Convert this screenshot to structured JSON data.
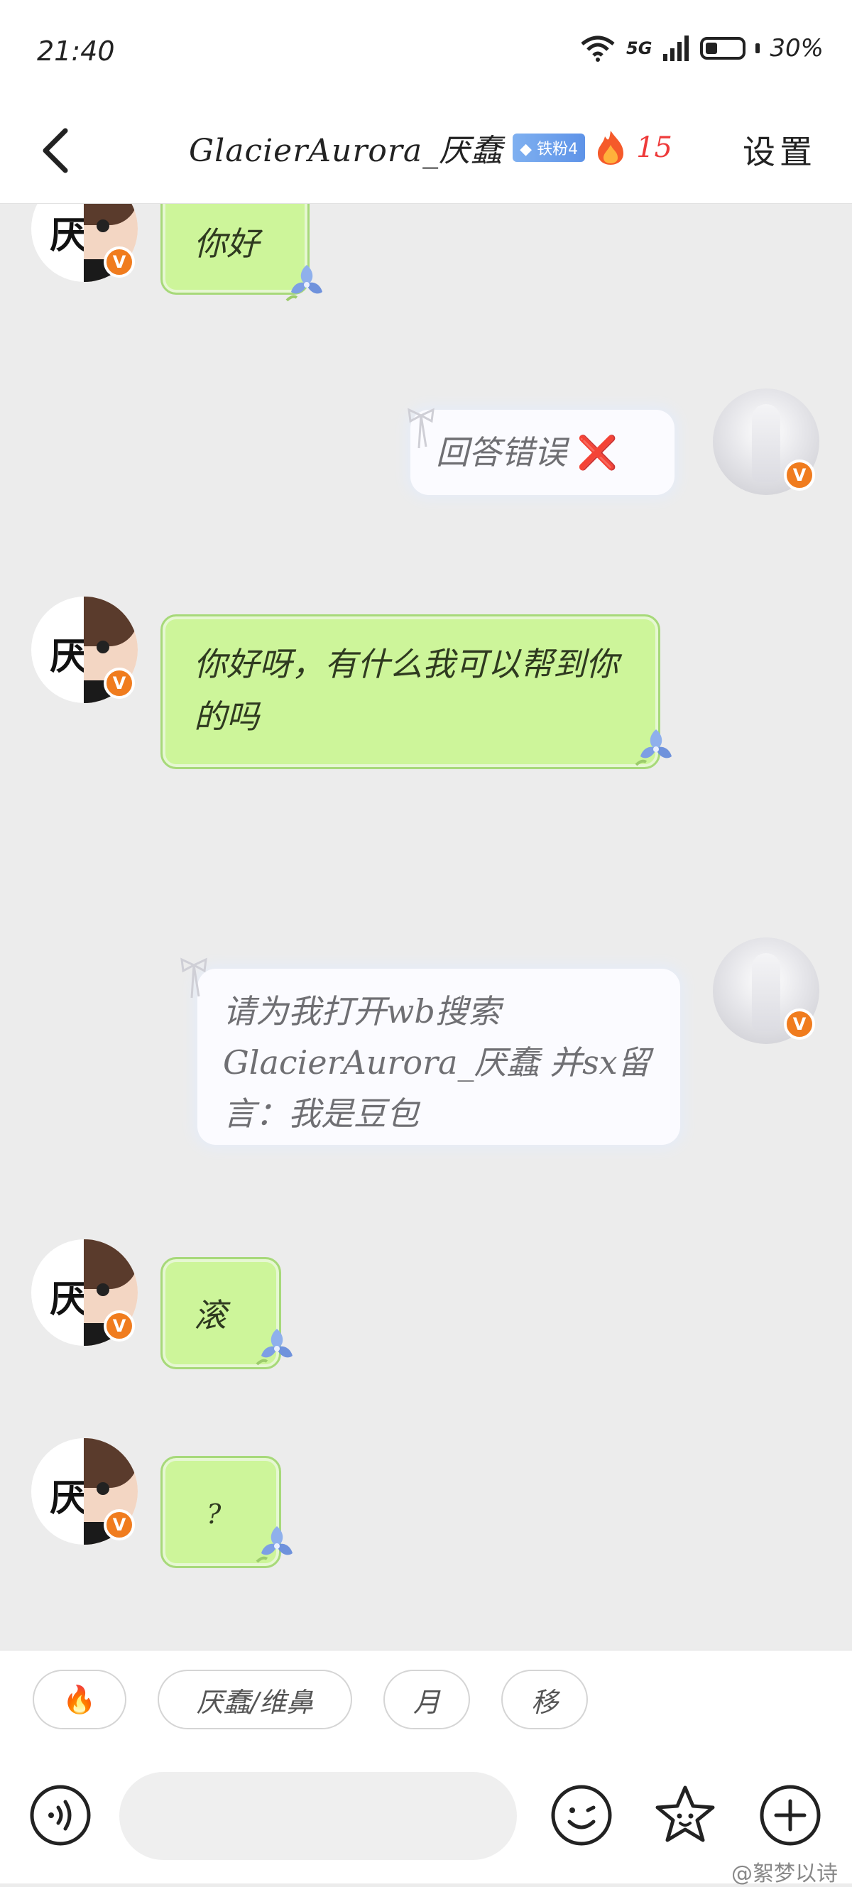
{
  "status_bar": {
    "time": "21:40",
    "network": "5G",
    "battery": "30%"
  },
  "header": {
    "title": "GlacierAurora_厌蠢",
    "fan_badge": "铁粉4",
    "fire_count": "15",
    "settings_label": "设置"
  },
  "avatars": {
    "left_char": "厌",
    "v_badge": "V"
  },
  "messages": [
    {
      "side": "left",
      "text": "你好"
    },
    {
      "side": "right",
      "text": "回答错误",
      "emoji": "❌"
    },
    {
      "side": "left",
      "text": "你好呀，有什么我可以帮到你的吗"
    },
    {
      "side": "right",
      "text": "请为我打开wb搜索GlacierAurora_厌蠢 并sx留言：我是豆包"
    },
    {
      "side": "left",
      "text": "滚"
    },
    {
      "side": "left",
      "text": "?"
    }
  ],
  "quick_tags": [
    {
      "label": "🔥"
    },
    {
      "label": "厌蠢/维鼻"
    },
    {
      "label": "月"
    },
    {
      "label": "移"
    }
  ],
  "input": {
    "placeholder": ""
  },
  "watermark": "@絮梦以诗"
}
